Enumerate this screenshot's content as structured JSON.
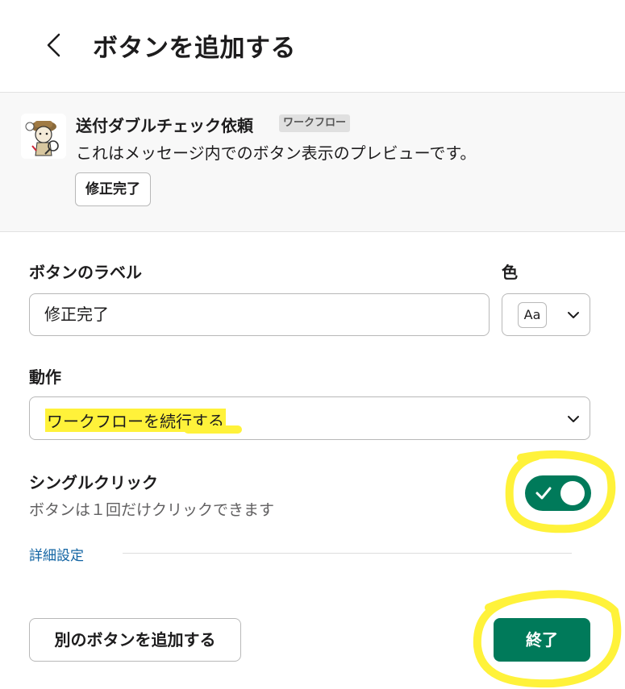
{
  "header": {
    "title": "ボタンを追加する",
    "back_icon": "chevron-left-icon"
  },
  "preview": {
    "workflow_name": "送付ダブルチェック依頼",
    "badge": "ワークフロー",
    "message": "これはメッセージ内でのボタン表示のプレビューです。",
    "button_label": "修正完了"
  },
  "form": {
    "label_field_title": "ボタンのラベル",
    "label_value": "修正完了",
    "color_title": "色",
    "color_swatch_text": "Aa",
    "action_title": "動作",
    "action_value": "ワークフローを続行する",
    "single_click_title": "シングルクリック",
    "single_click_desc": "ボタンは１回だけクリックできます",
    "single_click_enabled": true,
    "advanced_link": "詳細設定"
  },
  "footer": {
    "add_another": "別のボタンを追加する",
    "done": "終了"
  },
  "colors": {
    "accent": "#007a5a",
    "highlight": "#fff23a",
    "link": "#1264a3"
  }
}
